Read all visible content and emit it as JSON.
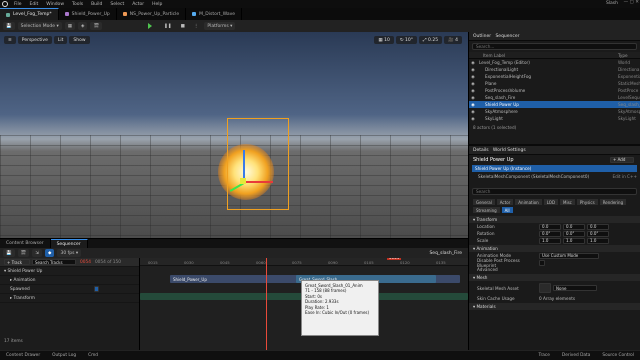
{
  "menubar": {
    "items": [
      "File",
      "Edit",
      "Window",
      "Tools",
      "Build",
      "Select",
      "Actor",
      "Help"
    ],
    "project": "Slash"
  },
  "tabs": [
    "Level_Fog_Temp*",
    "Shield_Power_Up",
    "NS_Power_Up_Particle",
    "M_Distort_Wave"
  ],
  "toolbar": {
    "save": "Save",
    "selection_mode": "Selection Mode",
    "platforms": "Platforms"
  },
  "viewport": {
    "perspective": "Perspective",
    "lit": "Lit",
    "show": "Show",
    "grid_snap": "10",
    "rot_snap": "10°",
    "scale_snap": "0.25",
    "cam_speed": "4"
  },
  "outliner": {
    "title": "Outliner",
    "sequencer_tab": "Sequencer",
    "search_placeholder": "Search...",
    "col_label": "Item Label",
    "col_type": "Type",
    "rows": [
      {
        "label": "Level_Fog_Temp (Editor)",
        "type": "World",
        "sel": false
      },
      {
        "label": "DirectionalLight",
        "type": "Directiona",
        "sel": false
      },
      {
        "label": "ExponentialHeightFog",
        "type": "Exponential",
        "sel": false
      },
      {
        "label": "Plane",
        "type": "StaticMesh",
        "sel": false
      },
      {
        "label": "PostProcessVolume",
        "type": "PostProce",
        "sel": false
      },
      {
        "label": "Seq_slash_Fire",
        "type": "LevelSeque",
        "sel": false
      },
      {
        "label": "Shield Power Up",
        "type": "Seq_slash_Fire",
        "sel": true
      },
      {
        "label": "SkyAtmosphere",
        "type": "SkyAtmosp",
        "sel": false
      },
      {
        "label": "SkyLight",
        "type": "SkyLight",
        "sel": false
      }
    ],
    "count": "8 actors (1 selected)"
  },
  "details": {
    "title": "Details",
    "world_settings": "World Settings",
    "actor": "Shield Power Up",
    "add": "+ Add",
    "instance": "Shield Power Up (Instance)",
    "component": "SkeletalMeshComponent (SkeletalMeshComponent0)",
    "edit_cpp": "Edit in C++",
    "search_placeholder": "Search",
    "filters": [
      "General",
      "Actor",
      "Animation",
      "LOD",
      "Misc",
      "Physics",
      "Rendering",
      "Streaming",
      "All"
    ],
    "transform": "Transform",
    "location": {
      "label": "Location",
      "x": "0.0",
      "y": "0.0",
      "z": "0.0"
    },
    "rotation": {
      "label": "Rotation",
      "x": "0.0°",
      "y": "0.0°",
      "z": "0.0°"
    },
    "scale": {
      "label": "Scale",
      "x": "1.0",
      "y": "1.0",
      "z": "1.0"
    },
    "animation": "Animation",
    "anim_mode": {
      "label": "Animation Mode",
      "value": "Use Custom Mode"
    },
    "disable_pp": "Disable Post Process Blueprint",
    "advanced": "Advanced",
    "mesh": "Mesh",
    "skeletal_mesh": {
      "label": "Skeletal Mesh Asset",
      "value": "None"
    },
    "skin_cache": {
      "label": "Skin Cache Usage",
      "value": "0 Array elements"
    },
    "materials": "Materials"
  },
  "sequencer": {
    "tab_content": "Content Browser",
    "tab_seq": "Sequencer",
    "fps": "30 fps",
    "seq_name": "Seq_slash_Fire",
    "search_placeholder": "Search Tracks",
    "frame": "0054",
    "of": "0054 of 150",
    "add_track": "+ Track",
    "tracks": [
      "Shield Power Up",
      "Animation",
      "Spawned",
      "Transform"
    ],
    "ticks": [
      "0015",
      "0030",
      "0045",
      "0060",
      "0075",
      "0090",
      "0105",
      "0120",
      "0135"
    ],
    "section1": "Shield_Power_Up",
    "section2": "Great_Sword_Slash",
    "items": "17 items",
    "tooltip": [
      "Great_Sword_Slash_01_Anim",
      "71 - 158 (88 frames)",
      "Start: 0s",
      "Duration: 2.933s",
      "Play Rate: 1",
      "Ease In: Cubic In/Out (0 frames)"
    ]
  },
  "statusbar": {
    "content_drawer": "Content Drawer",
    "output_log": "Output Log",
    "cmd": "Cmd",
    "trace": "Trace",
    "derived_data": "Derived Data",
    "source_control": "Source Control"
  }
}
